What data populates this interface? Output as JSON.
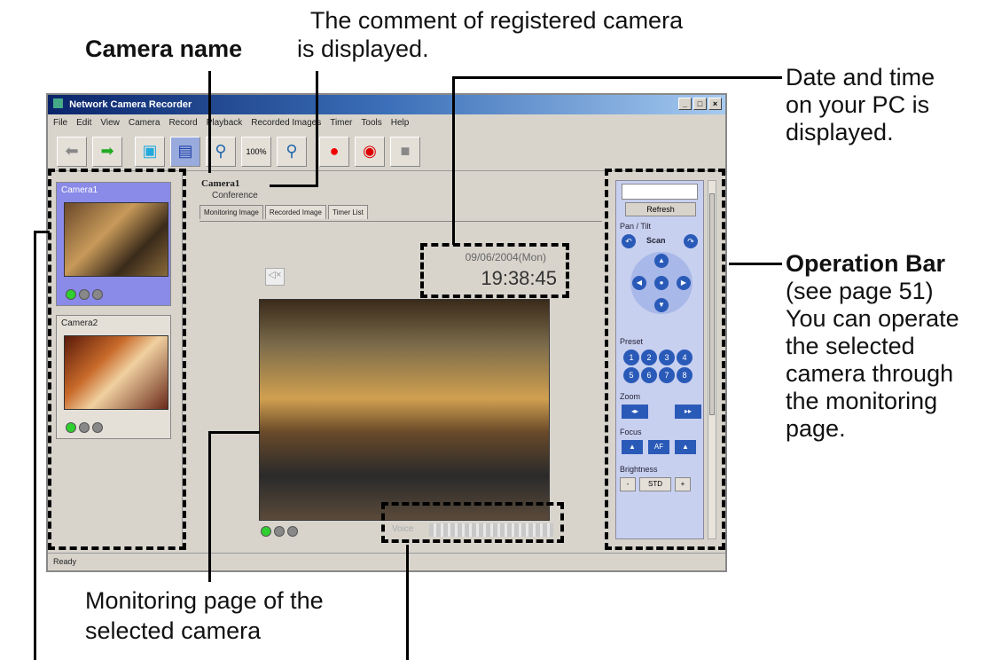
{
  "callouts": {
    "comment_line1": "The comment of registered camera",
    "comment_line2": "is displayed.",
    "camera_name": "Camera name",
    "datetime_line1": "Date and time",
    "datetime_line2": "on your PC is",
    "datetime_line3": "displayed.",
    "opbar_title": "Operation Bar",
    "opbar_line1": "(see page 51)",
    "opbar_line2": "You can operate",
    "opbar_line3": "the selected",
    "opbar_line4": "camera through",
    "opbar_line5": "the monitoring",
    "opbar_line6": "page.",
    "monitoring_line1": "Monitoring page of the",
    "monitoring_line2": "selected camera"
  },
  "window": {
    "title": "Network Camera Recorder",
    "menu": [
      "File",
      "Edit",
      "View",
      "Camera",
      "Record",
      "Playback",
      "Recorded Images",
      "Timer",
      "Tools",
      "Help"
    ],
    "zoom_label": "100%",
    "status": "Ready"
  },
  "left_panel": {
    "cameras": [
      {
        "name": "Camera1"
      },
      {
        "name": "Camera2"
      }
    ]
  },
  "main": {
    "camera_name": "Camera1",
    "comment": "Conference",
    "tabs": [
      "Monitoring Image",
      "Recorded Image",
      "Timer List"
    ],
    "date": "09/06/2004(Mon)",
    "time": "19:38:45",
    "volume_label": "Voice"
  },
  "operation_bar": {
    "refresh": "Refresh",
    "pan_tilt": "Pan / Tilt",
    "scan": "Scan",
    "preset": "Preset",
    "preset_numbers": [
      "1",
      "2",
      "3",
      "4",
      "5",
      "6",
      "7",
      "8"
    ],
    "zoom": "Zoom",
    "focus": "Focus",
    "focus_af": "AF",
    "brightness": "Brightness",
    "brightness_minus": "-",
    "brightness_std": "STD",
    "brightness_plus": "+"
  }
}
